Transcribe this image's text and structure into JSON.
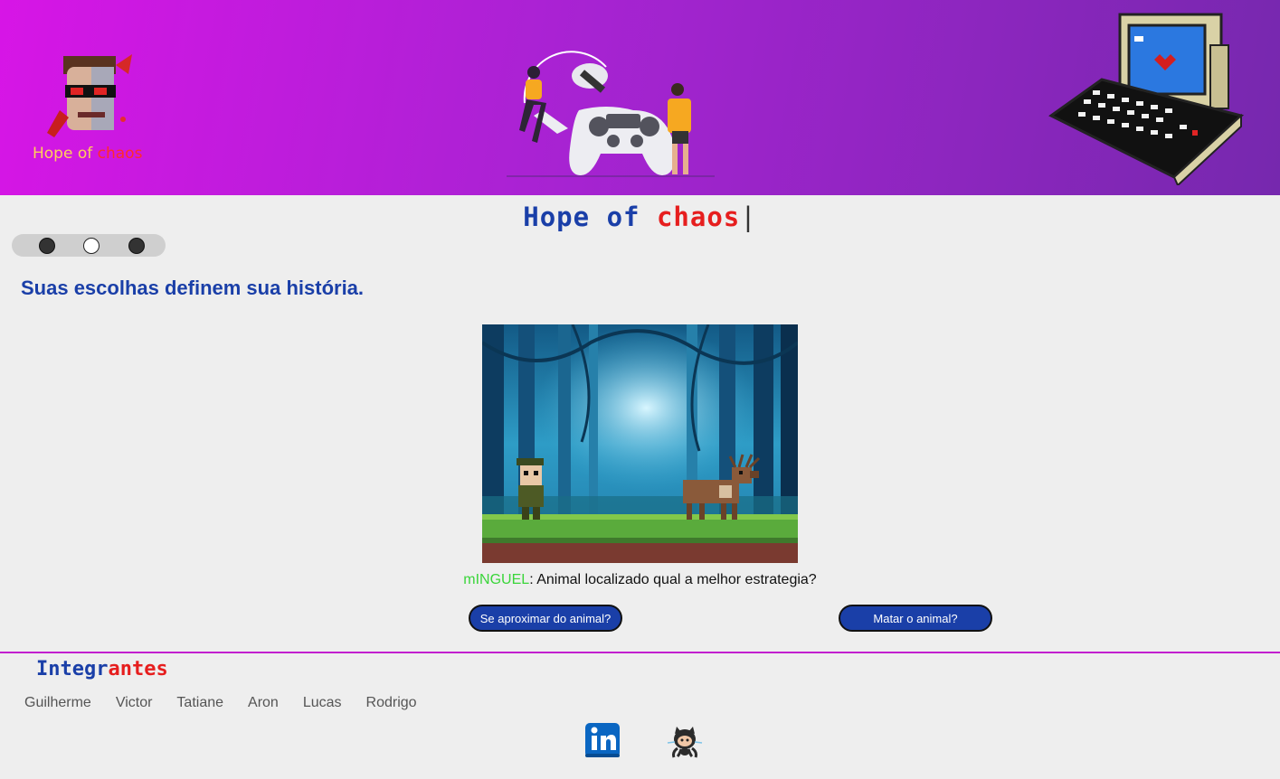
{
  "header": {
    "logo_text_1": "Hope of",
    "logo_text_2": "chaos",
    "logo_icon": "cyborg-face-icon",
    "hero_icon": "gamers-controller-illustration",
    "computer_icon": "retro-computer-icon"
  },
  "title": {
    "part1": "Hope of",
    "part2": "chaos",
    "cursor": "|"
  },
  "slider": {
    "dots": [
      "slide-1",
      "slide-2",
      "slide-3"
    ],
    "active_index": 1
  },
  "main": {
    "subtitle": "Suas escolhas definem sua história.",
    "scene_icon": "forest-hunter-deer-scene",
    "dialog_speaker": "mINGUEL",
    "dialog_text": ": Animal localizado qual a melhor estrategia?",
    "choice_1": "Se aproximar do animal?",
    "choice_2": "Matar o animal?"
  },
  "footer": {
    "team_title_1": "Integr",
    "team_title_2": "antes",
    "members": [
      "Guilherme",
      "Victor",
      "Tatiane",
      "Aron",
      "Lucas",
      "Rodrigo"
    ],
    "social": [
      "linkedin-icon",
      "github-icon"
    ]
  },
  "colors": {
    "header_gradient_start": "#d715e6",
    "header_gradient_end": "#7628ae",
    "primary_blue": "#1a3fa8",
    "accent_red": "#e61e1e",
    "speaker_green": "#3ad53a",
    "divider": "#c21fcf"
  }
}
